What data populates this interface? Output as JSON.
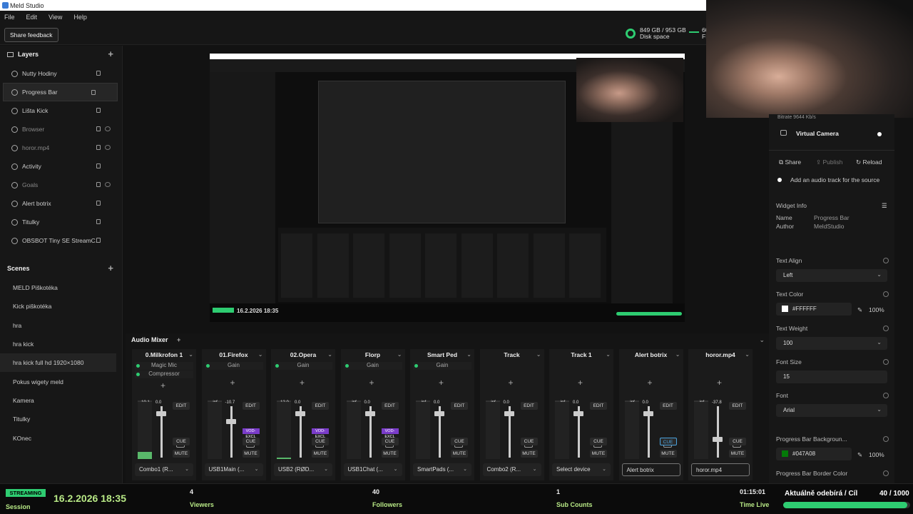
{
  "app": {
    "title": "Meld Studio"
  },
  "menu": [
    "File",
    "Edit",
    "View",
    "Help"
  ],
  "topbar": {
    "feedback_label": "Share feedback",
    "disk_value": "849 GB / 953 GB",
    "disk_label": "Disk space",
    "fps_value": "60.",
    "fps_label": "FP"
  },
  "layers": {
    "title": "Layers",
    "items": [
      {
        "label": "Nutty Hodiny",
        "dim": false
      },
      {
        "label": "Progress Bar",
        "dim": false
      },
      {
        "label": "Lišta Kick",
        "dim": false
      },
      {
        "label": "Browser",
        "dim": true
      },
      {
        "label": "horor.mp4",
        "dim": true
      },
      {
        "label": "Activity",
        "dim": false
      },
      {
        "label": "Goals",
        "dim": true
      },
      {
        "label": "Alert botrix",
        "dim": false
      },
      {
        "label": "Titulky",
        "dim": false
      },
      {
        "label": "OBSBOT Tiny SE StreamC...",
        "dim": false
      }
    ]
  },
  "scenes": {
    "title": "Scenes",
    "items": [
      "MELD Piškotéka",
      "Kick piškotéka",
      "hra",
      "hra kick",
      "hra kick full hd 1920×1080",
      "Pokus wigety meld",
      "Kamera",
      "Titulky",
      "KOnec"
    ]
  },
  "right": {
    "bitrate": "Bitrate  9644 Kb/s",
    "virtual_camera": "Virtual Camera",
    "share": "Share",
    "publish": "Publish",
    "reload": "Reload",
    "audio_track": "Add an audio track for the source",
    "widget_info": "Widget Info",
    "name_label": "Name",
    "name_value": "Progress Bar",
    "author_label": "Author",
    "author_value": "MeldStudio",
    "text_align_label": "Text Align",
    "text_align_value": "Left",
    "text_color_label": "Text Color",
    "text_color_value": "#FFFFFF",
    "text_color_opacity": "100%",
    "text_weight_label": "Text Weight",
    "text_weight_value": "100",
    "font_size_label": "Font Size",
    "font_size_value": "15",
    "font_label": "Font",
    "font_value": "Arial",
    "pb_bg_label": "Progress Bar Backgroun...",
    "pb_bg_value": "#047A08",
    "pb_bg_opacity": "100%",
    "pb_border_label": "Progress Bar Border Color"
  },
  "mixer": {
    "title": "Audio Mixer",
    "strips": [
      {
        "name": "0.Milkrofon 1",
        "fx": [
          "Magic Mic",
          "Compressor"
        ],
        "db_top": "-10.1",
        "db_val": "0.0",
        "meter": 0.12,
        "fader": 0.9,
        "vod": false,
        "cue_on": false,
        "device": "Combo1 (R...",
        "out": false
      },
      {
        "name": "01.Firefox",
        "fx": [
          "Gain"
        ],
        "db_top": "-inf",
        "db_val": "-10.7",
        "meter": 0.0,
        "fader": 0.75,
        "vod": true,
        "cue_on": false,
        "device": "USB1Main (...",
        "out": false
      },
      {
        "name": "02.Opera",
        "fx": [
          "Gain"
        ],
        "db_top": "-12.0",
        "db_val": "0.0",
        "meter": 0.03,
        "fader": 0.9,
        "vod": true,
        "cue_on": false,
        "device": "USB2 (RØD...",
        "out": false
      },
      {
        "name": "Florp",
        "fx": [
          "Gain"
        ],
        "db_top": "-inf",
        "db_val": "0.0",
        "meter": 0.0,
        "fader": 0.9,
        "vod": true,
        "cue_on": false,
        "device": "USB1Chat (...",
        "out": false
      },
      {
        "name": "Smart Ped",
        "fx": [
          "Gain"
        ],
        "db_top": "-inf",
        "db_val": "0.0",
        "meter": 0.0,
        "fader": 0.9,
        "vod": false,
        "cue_on": false,
        "device": "SmartPads (...",
        "out": false
      },
      {
        "name": "Track",
        "fx": [],
        "db_top": "-inf",
        "db_val": "0.0",
        "meter": 0.0,
        "fader": 0.9,
        "vod": false,
        "cue_on": false,
        "device": "Combo2 (R...",
        "out": false
      },
      {
        "name": "Track 1",
        "fx": [],
        "db_top": "-inf",
        "db_val": "0.0",
        "meter": 0.0,
        "fader": 0.9,
        "vod": false,
        "cue_on": false,
        "device": "Select device",
        "out": false
      },
      {
        "name": "Alert botrix",
        "fx": [],
        "db_top": "-inf",
        "db_val": "0.0",
        "meter": 0.0,
        "fader": 0.9,
        "vod": false,
        "cue_on": true,
        "device": "Alert botrix",
        "out": true
      },
      {
        "name": "horor.mp4",
        "fx": [],
        "db_top": "-inf",
        "db_val": "-37.8",
        "meter": 0.0,
        "fader": 0.4,
        "vod": false,
        "cue_on": false,
        "device": "horor.mp4",
        "out": true
      }
    ],
    "edit": "EDIT",
    "cue": "CUE",
    "mute": "MUTE",
    "vod_label": "VOD-EXCL"
  },
  "status": {
    "streaming": "STREAMING",
    "date": "16.2.2026 18:35",
    "session": "Session",
    "viewers_value": "4",
    "viewers_label": "Viewers",
    "followers_value": "40",
    "followers_label": "Followers",
    "subs_value": "1",
    "subs_label": "Sub Counts",
    "time_value": "01:15:01",
    "time_label": "Time Live",
    "goal_label": "Aktuálně odebírá / Cíl",
    "goal_value": "40 / 1000",
    "goal_progress": 0.98
  },
  "preview_strip_names": [
    "0.Milkrofon 1",
    "01.Firefox",
    "02.Opera",
    "Florp",
    "Smart Ped",
    "Track",
    "Track 1",
    "Alert botrix",
    "horor.mp4"
  ]
}
